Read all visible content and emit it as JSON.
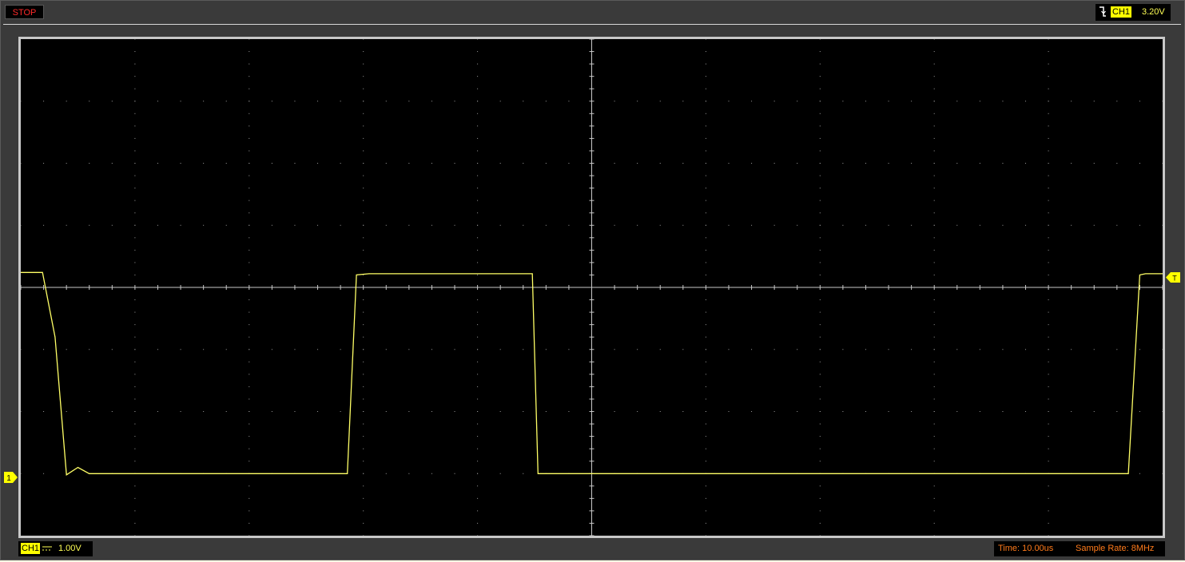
{
  "status": {
    "run_state": "STOP"
  },
  "trigger": {
    "edge": "falling-edge-icon",
    "channel": "CH1",
    "level": "3.20V",
    "marker_label": "T"
  },
  "channel": {
    "label": "CH1",
    "coupling": "dc-coupling-icon",
    "scale": "1.00V",
    "marker_label": "1"
  },
  "timebase": {
    "time_per_div": "Time: 10.00us",
    "sample_rate": "Sample Rate: 8MHz"
  },
  "colors": {
    "trace": "#ffff66",
    "grid": "#9a9a9a",
    "status_red": "#ff2a2a",
    "info_orange": "#ff7a1a",
    "badge_yellow": "#ffff00"
  },
  "grid": {
    "h_divisions": 10,
    "v_divisions": 8
  },
  "chart_data": {
    "type": "line",
    "title": "",
    "xlabel": "",
    "ylabel": "",
    "xlim": [
      0,
      100
    ],
    "ylim": [
      -4,
      4
    ],
    "x_unit": "us",
    "y_unit": "V",
    "series": [
      {
        "x": [
          0,
          1.9,
          3.0,
          4.0,
          5.0,
          6.0,
          10.0,
          20.0,
          28.6,
          29.4,
          30.5,
          40.0,
          44.8,
          45.3,
          46.2,
          47.3,
          48.0,
          55.0,
          60.0,
          80.0,
          90.0,
          97.0,
          98.0,
          98.5,
          100.0
        ],
        "y": [
          0.24,
          0.24,
          -0.8,
          -3.02,
          -2.9,
          -3.0,
          -3.0,
          -3.0,
          -3.0,
          0.2,
          0.22,
          0.22,
          0.22,
          -3.0,
          -3.0,
          -3.0,
          -3.0,
          -3.0,
          -3.0,
          -3.0,
          -3.0,
          -3.0,
          0.2,
          0.22,
          0.22
        ]
      }
    ]
  }
}
